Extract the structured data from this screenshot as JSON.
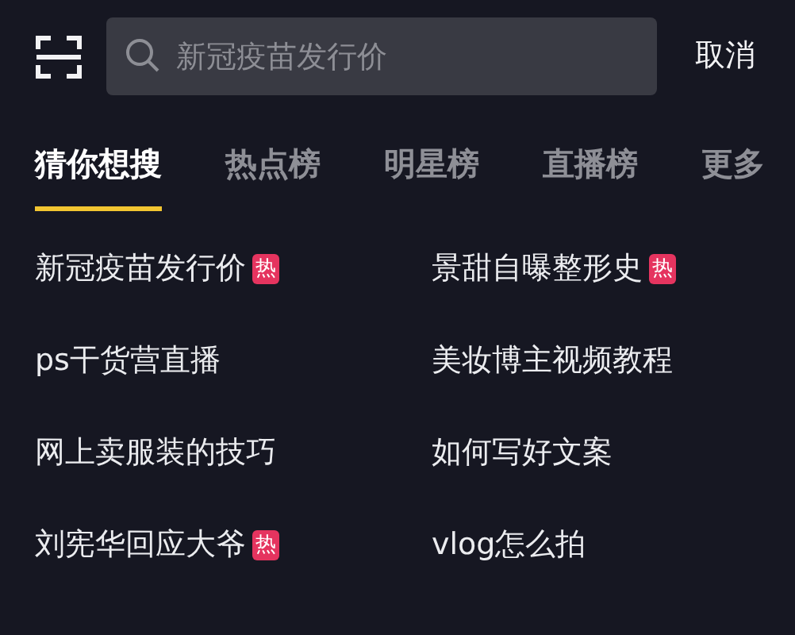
{
  "search": {
    "placeholder": "新冠疫苗发行价"
  },
  "cancel": "取消",
  "tabs": [
    {
      "label": "猜你想搜",
      "selected": true
    },
    {
      "label": "热点榜",
      "selected": false
    },
    {
      "label": "明星榜",
      "selected": false
    },
    {
      "label": "直播榜",
      "selected": false
    },
    {
      "label": "更多",
      "selected": false
    }
  ],
  "suggestions": [
    {
      "text": "新冠疫苗发行价",
      "badge": "热"
    },
    {
      "text": "景甜自曝整形史",
      "badge": "热"
    },
    {
      "text": "ps干货营直播"
    },
    {
      "text": "美妆博主视频教程"
    },
    {
      "text": "网上卖服装的技巧"
    },
    {
      "text": "如何写好文案"
    },
    {
      "text": "刘宪华回应大爷",
      "badge": "热"
    },
    {
      "text": "vlog怎么拍"
    }
  ]
}
